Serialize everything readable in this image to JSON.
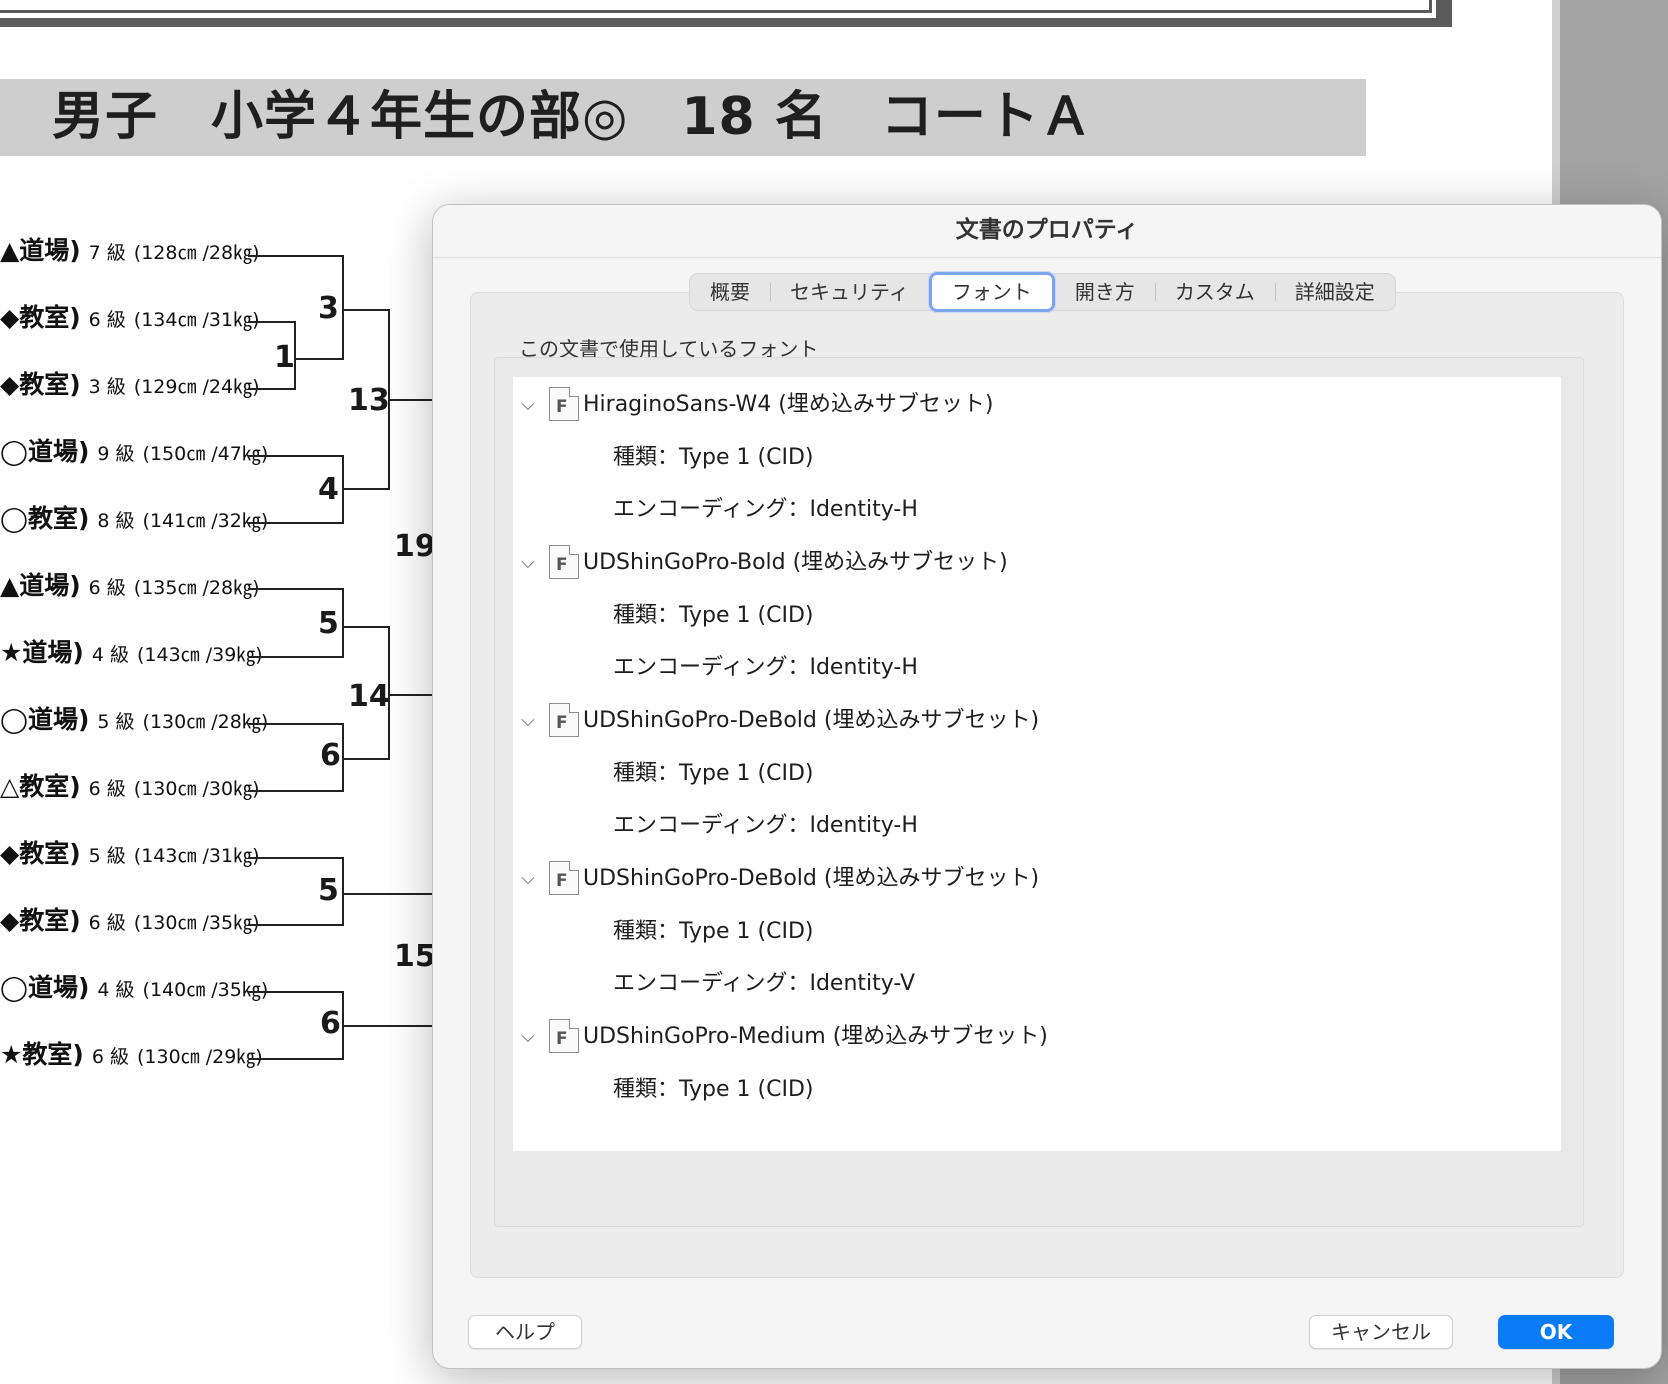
{
  "header": {
    "title": "男子　小学４年生の部◎　18 名　コートＡ"
  },
  "bracket": {
    "entries": [
      {
        "dojo": "▲道場)",
        "rank": "7 級",
        "stat": "(128㎝ /28㎏)"
      },
      {
        "dojo": "◆教室)",
        "rank": "6 級",
        "stat": "(134㎝ /31㎏)"
      },
      {
        "dojo": "◆教室)",
        "rank": "3 級",
        "stat": "(129㎝ /24㎏)"
      },
      {
        "dojo": "◯道場)",
        "rank": "9 級",
        "stat": "(150㎝ /47㎏)"
      },
      {
        "dojo": "◯教室)",
        "rank": "8 級",
        "stat": "(141㎝ /32㎏)"
      },
      {
        "dojo": "▲道場)",
        "rank": "6 級",
        "stat": "(135㎝ /28㎏)"
      },
      {
        "dojo": "★道場)",
        "rank": "4 級",
        "stat": "(143㎝ /39㎏)"
      },
      {
        "dojo": "◯道場)",
        "rank": "5 級",
        "stat": "(130㎝ /28㎏)"
      },
      {
        "dojo": "△教室)",
        "rank": "6 級",
        "stat": "(130㎝ /30㎏)"
      },
      {
        "dojo": "◆教室)",
        "rank": "5 級",
        "stat": "(143㎝ /31㎏)"
      },
      {
        "dojo": "◆教室)",
        "rank": "6 級",
        "stat": "(130㎝ /35㎏)"
      },
      {
        "dojo": "◯道場)",
        "rank": "4 級",
        "stat": "(140㎝ /35㎏)"
      },
      {
        "dojo": "★教室)",
        "rank": "6 級",
        "stat": "(130㎝ /29㎏)"
      }
    ],
    "match_numbers": [
      "3",
      "1",
      "13",
      "4",
      "19",
      "5",
      "14",
      "6",
      "5",
      "15",
      "6"
    ]
  },
  "dialog": {
    "title": "文書のプロパティ",
    "tabs": [
      "概要",
      "セキュリティ",
      "フォント",
      "開き方",
      "カスタム",
      "詳細設定"
    ],
    "active_tab": "フォント",
    "section_label": "この文書で使用しているフォント",
    "icon_letter": "F",
    "fonts": [
      {
        "name": "HiraginoSans-W4 (埋め込みサブセット)",
        "type": "種類：Type 1 (CID)",
        "encoding": "エンコーディング：Identity-H"
      },
      {
        "name": "UDShinGoPro-Bold (埋め込みサブセット)",
        "type": "種類：Type 1 (CID)",
        "encoding": "エンコーディング：Identity-H"
      },
      {
        "name": "UDShinGoPro-DeBold (埋め込みサブセット)",
        "type": "種類：Type 1 (CID)",
        "encoding": "エンコーディング：Identity-H"
      },
      {
        "name": "UDShinGoPro-DeBold (埋め込みサブセット)",
        "type": "種類：Type 1 (CID)",
        "encoding": "エンコーディング：Identity-V"
      },
      {
        "name": "UDShinGoPro-Medium (埋め込みサブセット)",
        "type": "種類：Type 1 (CID)"
      }
    ],
    "buttons": {
      "help": "ヘルプ",
      "cancel": "キャンセル",
      "ok": "OK"
    }
  }
}
